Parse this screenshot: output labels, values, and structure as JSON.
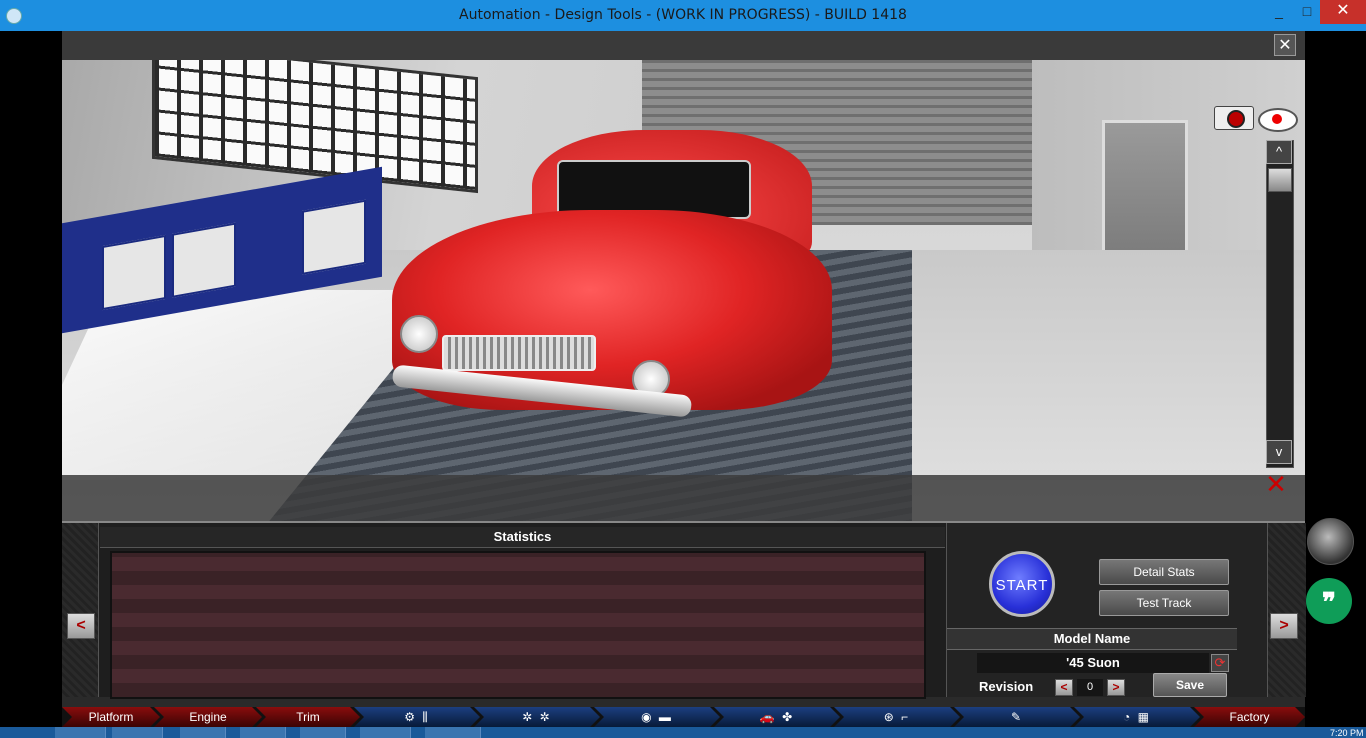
{
  "window": {
    "title": "Automation - Design Tools - (WORK IN PROGRESS) - BUILD 1418",
    "minimize": "_",
    "maximize": "□",
    "close": "✕"
  },
  "viewport": {
    "close_label": "✕",
    "scroll_up": "^",
    "scroll_down": "v",
    "hide_ui": "✕"
  },
  "panel": {
    "prev": "<",
    "next": ">",
    "statistics_title": "Statistics",
    "start_label": "START",
    "detail_stats_label": "Detail Stats",
    "test_track_label": "Test Track",
    "model_name_title": "Model Name",
    "model_name_value": "'45 Suon",
    "revision_label": "Revision",
    "revision_prev": "<",
    "revision_value": "0",
    "revision_next": ">",
    "save_label": "Save"
  },
  "tabs": [
    {
      "label": "Platform"
    },
    {
      "label": "Engine"
    },
    {
      "label": "Trim"
    },
    {
      "label": "Factory"
    }
  ],
  "taskbar": {
    "clock": "7:20 PM"
  },
  "colors": {
    "title_bar": "#1d8fe0",
    "close_button": "#c7302a",
    "start_button": "#2830d8",
    "tab_red": "#8a0d0d",
    "tab_blue": "#1c3f80",
    "hangouts": "#0f9d58"
  },
  "icons": [
    "camera-icon",
    "eye-icon",
    "refresh-icon",
    "gear-icon",
    "wheel-icon",
    "car-icon",
    "fan-icon",
    "steering-wheel-icon",
    "seat-icon",
    "spray-icon",
    "gauge-icon",
    "checkered-flag-icon"
  ]
}
